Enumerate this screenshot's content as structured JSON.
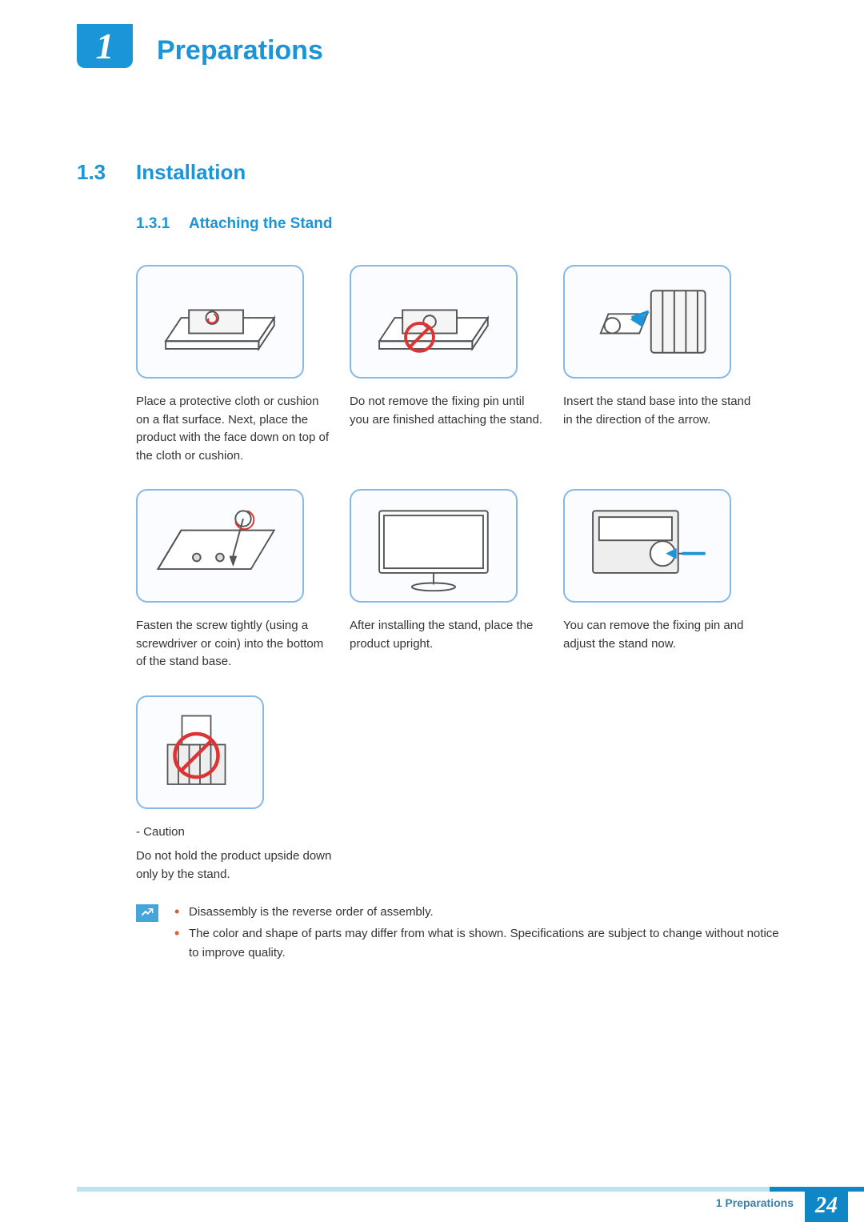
{
  "header": {
    "chapter_number": "1",
    "chapter_title": "Preparations"
  },
  "section": {
    "number": "1.3",
    "title": "Installation"
  },
  "subsection": {
    "number": "1.3.1",
    "title": "Attaching the Stand"
  },
  "steps": [
    {
      "caption": "Place a protective cloth or cushion on a flat surface. Next, place the product with the face down on top of the cloth or cushion."
    },
    {
      "caption": "Do not remove the fixing pin until you are finished attaching the stand."
    },
    {
      "caption": "Insert the stand base into the stand in the direction of the arrow."
    },
    {
      "caption": "Fasten the screw tightly (using a screwdriver or coin) into the bottom of the stand base."
    },
    {
      "caption": "After installing the stand, place the product upright."
    },
    {
      "caption": "You can remove the fixing pin and adjust the stand now."
    },
    {
      "caption_prefix": "- Caution",
      "caption": "Do not hold the product upside down only by the stand."
    }
  ],
  "notes": [
    "Disassembly is the reverse order of assembly.",
    "The color and shape of parts may differ from what is shown. Specifications are subject to change without notice to improve quality."
  ],
  "footer": {
    "label": "1 Preparations",
    "page": "24"
  }
}
